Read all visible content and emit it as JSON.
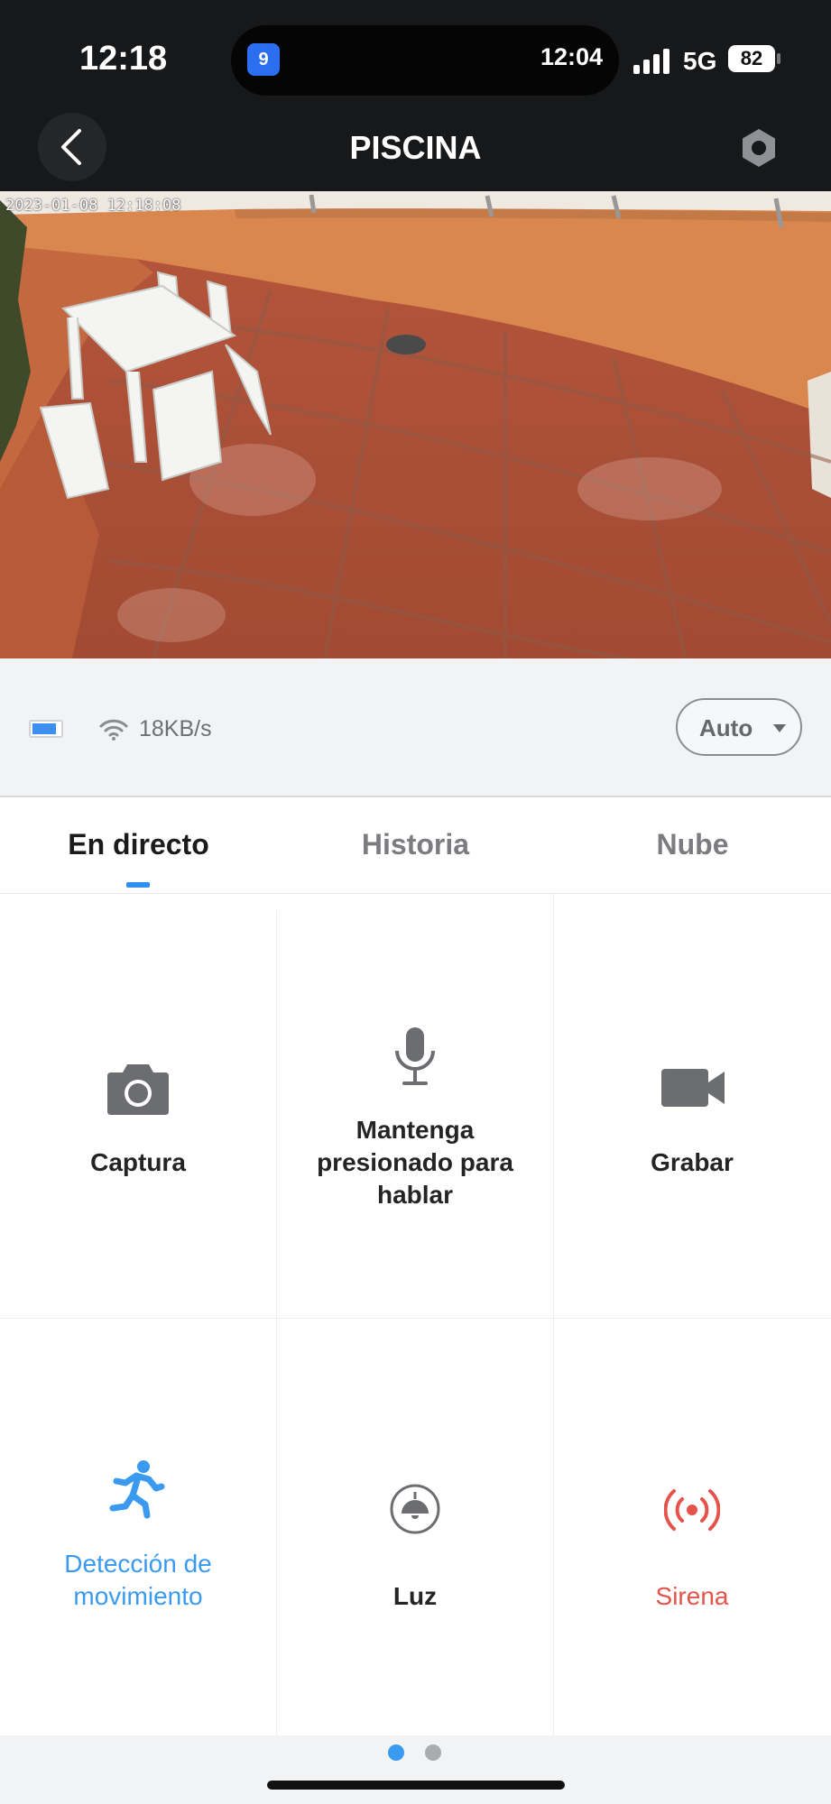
{
  "status_bar": {
    "time": "12:18",
    "island_badge": "9",
    "island_time": "12:04",
    "network": "5G",
    "battery": "82"
  },
  "header": {
    "title": "PISCINA"
  },
  "video": {
    "timestamp": "2023-01-08 12:18:08"
  },
  "info_bar": {
    "speed": "18KB/s",
    "quality": "Auto"
  },
  "tabs": [
    {
      "label": "En directo",
      "active": true
    },
    {
      "label": "Historia",
      "active": false
    },
    {
      "label": "Nube",
      "active": false
    }
  ],
  "controls": {
    "capture": "Captura",
    "talk": "Mantenga presionado para hablar",
    "record": "Grabar",
    "motion": "Detección de movimiento",
    "light": "Luz",
    "siren": "Sirena"
  },
  "colors": {
    "accent_blue": "#3a9af0",
    "siren_red": "#e5534b",
    "icon_gray": "#6b6d70"
  },
  "pager": {
    "active_page": 1,
    "page_count": 2
  }
}
